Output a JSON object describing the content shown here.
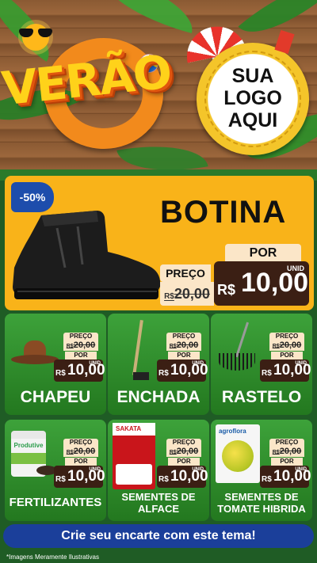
{
  "header": {
    "title": "VERÃO",
    "logo_lines": [
      "SUA",
      "LOGO",
      "AQUI"
    ]
  },
  "feature": {
    "discount": "-50%",
    "name": "BOTINA",
    "price_label": "PREÇO",
    "old_currency": "R$",
    "old_price": "20,00",
    "por_label": "POR",
    "unit_label": "UNID",
    "new_currency": "R$",
    "new_price": "10,00"
  },
  "products": [
    {
      "name": "CHAPEU",
      "price_label": "PREÇO",
      "old_currency": "R$",
      "old_price": "20,00",
      "por_label": "POR",
      "unit_label": "UNID",
      "new_currency": "R$",
      "new_price": "10,00"
    },
    {
      "name": "ENCHADA",
      "price_label": "PREÇO",
      "old_currency": "R$",
      "old_price": "20,00",
      "por_label": "POR",
      "unit_label": "UNID",
      "new_currency": "R$",
      "new_price": "10,00"
    },
    {
      "name": "RASTELO",
      "price_label": "PREÇO",
      "old_currency": "R$",
      "old_price": "20,00",
      "por_label": "POR",
      "unit_label": "UNID",
      "new_currency": "R$",
      "new_price": "10,00"
    },
    {
      "name": "FERTILIZANTES",
      "price_label": "PREÇO",
      "old_currency": "R$",
      "old_price": "20,00",
      "por_label": "POR",
      "unit_label": "UNID",
      "new_currency": "R$",
      "new_price": "10,00",
      "package_text": "Produtive"
    },
    {
      "name_line1": "SEMENTES DE",
      "name_line2": "ALFACE",
      "price_label": "PREÇO",
      "old_currency": "R$",
      "old_price": "20,00",
      "por_label": "POR",
      "unit_label": "UNID",
      "new_currency": "R$",
      "new_price": "10,00",
      "package_text": "SAKATA"
    },
    {
      "name_line1": "SEMENTES DE",
      "name_line2": "TOMATE HIBRIDA",
      "price_label": "PREÇO",
      "old_currency": "R$",
      "old_price": "20,00",
      "por_label": "POR",
      "unit_label": "UNID",
      "new_currency": "R$",
      "new_price": "10,00",
      "package_text": "agroflora"
    }
  ],
  "cta": {
    "label": "Crie seu encarte com este tema!"
  },
  "disclaimer": "*Imagens Meramente Ilustrativas",
  "colors": {
    "feature_bg": "#f9b319",
    "card_green": "#2e8f2a",
    "price_dark": "#3b1f14",
    "tag_cream": "#fbe6c8",
    "cta_blue": "#1b3f9a",
    "discount_blue": "#1d4dac"
  },
  "icons": [
    "sun-icon",
    "sunglasses-icon",
    "beach-ball-icon",
    "umbrella-icon",
    "boot-icon",
    "hat-icon",
    "hoe-icon",
    "rake-icon",
    "fertilizer-bag-icon",
    "seed-packet-icon"
  ]
}
